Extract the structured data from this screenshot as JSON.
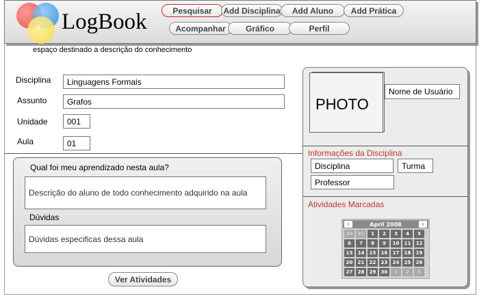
{
  "header": {
    "logo_text": "LogBook",
    "nav_row1": [
      "Pesquisar",
      "Add Disciplina",
      "Add Aluno",
      "Add Prática"
    ],
    "nav_row2": [
      "Acompanhar",
      "Gráfico",
      "Perfil"
    ],
    "active_nav": "Pesquisar",
    "logo_colors": [
      "#e53935",
      "#1e88e5",
      "#fdd835"
    ],
    "active_border_color": "#c62828"
  },
  "page_description": "espaço destinado a descrição do conhecimento",
  "form": {
    "disciplina_label": "Disciplina",
    "disciplina_value": "Linguagens Formais",
    "assunto_label": "Assunto",
    "assunto_value": "Grafos",
    "unidade_label": "Unidade",
    "unidade_value": "001",
    "aula_label": "Aula",
    "aula_value": "01"
  },
  "learning": {
    "question": "Qual foi meu aprendizado nesta aula?",
    "description_text": "Descrição do aluno de todo conhecimento adquirido na aula",
    "duvidas_label": "Dúvidas",
    "duvidas_text": "Dúvidas especificas dessa aula"
  },
  "ver_atividades_label": "Ver Atividades",
  "profile": {
    "photo_label": "PHOTO",
    "username": "Nome de Usuário",
    "info_title": "Informações da Disciplina",
    "disciplina_field": "Disciplina",
    "turma_field": "Turma",
    "professor_field": "Professor",
    "atividades_title": "Atividades Marcadas",
    "section_title_color": "#c0392b"
  },
  "calendar": {
    "month_label": "April 2008",
    "prev_icon": "chevron-left-icon",
    "next_icon": "chevron-right-icon",
    "days": [
      {
        "d": "30",
        "other": true
      },
      {
        "d": "31",
        "other": true
      },
      {
        "d": "1"
      },
      {
        "d": "2"
      },
      {
        "d": "3"
      },
      {
        "d": "4"
      },
      {
        "d": "5"
      },
      {
        "d": "6"
      },
      {
        "d": "7"
      },
      {
        "d": "8"
      },
      {
        "d": "9"
      },
      {
        "d": "10"
      },
      {
        "d": "11"
      },
      {
        "d": "12"
      },
      {
        "d": "13"
      },
      {
        "d": "14"
      },
      {
        "d": "15"
      },
      {
        "d": "16"
      },
      {
        "d": "17"
      },
      {
        "d": "18"
      },
      {
        "d": "19"
      },
      {
        "d": "20"
      },
      {
        "d": "21"
      },
      {
        "d": "22"
      },
      {
        "d": "23"
      },
      {
        "d": "24"
      },
      {
        "d": "25"
      },
      {
        "d": "26"
      },
      {
        "d": "27"
      },
      {
        "d": "28"
      },
      {
        "d": "29"
      },
      {
        "d": "30"
      },
      {
        "d": "1",
        "other": true
      },
      {
        "d": "2",
        "other": true
      },
      {
        "d": "3",
        "other": true
      }
    ]
  }
}
